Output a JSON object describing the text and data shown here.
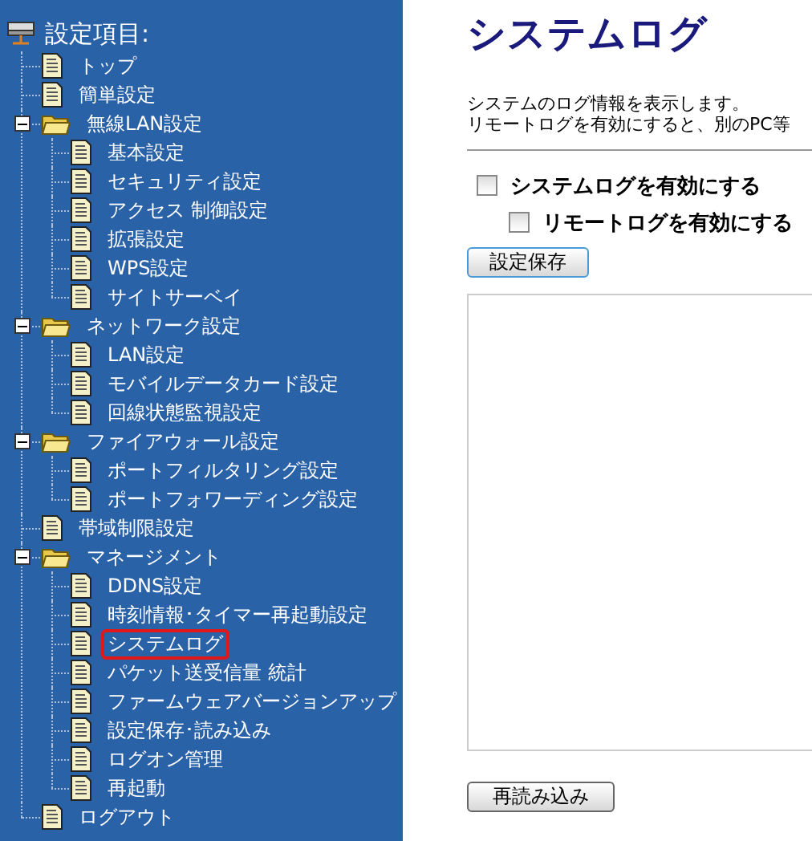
{
  "sidebar": {
    "title": "設定項目:",
    "items": [
      {
        "kind": "page",
        "label": "トップ",
        "selected": false
      },
      {
        "kind": "page",
        "label": "簡単設定",
        "selected": false
      },
      {
        "kind": "folder",
        "label": "無線LAN設定",
        "selected": false,
        "expanded": true,
        "children": [
          {
            "kind": "page",
            "label": "基本設定",
            "selected": false
          },
          {
            "kind": "page",
            "label": "セキュリティ設定",
            "selected": false
          },
          {
            "kind": "page",
            "label": "アクセス 制御設定",
            "selected": false
          },
          {
            "kind": "page",
            "label": "拡張設定",
            "selected": false
          },
          {
            "kind": "page",
            "label": "WPS設定",
            "selected": false
          },
          {
            "kind": "page",
            "label": "サイトサーベイ",
            "selected": false
          }
        ]
      },
      {
        "kind": "folder",
        "label": "ネットワーク設定",
        "selected": false,
        "expanded": true,
        "children": [
          {
            "kind": "page",
            "label": "LAN設定",
            "selected": false
          },
          {
            "kind": "page",
            "label": "モバイルデータカード設定",
            "selected": false
          },
          {
            "kind": "page",
            "label": "回線状態監視設定",
            "selected": false
          }
        ]
      },
      {
        "kind": "folder",
        "label": "ファイアウォール設定",
        "selected": false,
        "expanded": true,
        "children": [
          {
            "kind": "page",
            "label": "ポートフィルタリング設定",
            "selected": false
          },
          {
            "kind": "page",
            "label": "ポートフォワーディング設定",
            "selected": false
          }
        ]
      },
      {
        "kind": "page",
        "label": "帯域制限設定",
        "selected": false
      },
      {
        "kind": "folder",
        "label": "マネージメント",
        "selected": false,
        "expanded": true,
        "children": [
          {
            "kind": "page",
            "label": "DDNS設定",
            "selected": false
          },
          {
            "kind": "page",
            "label": "時刻情報･タイマー再起動設定",
            "selected": false
          },
          {
            "kind": "page",
            "label": "システムログ",
            "selected": true
          },
          {
            "kind": "page",
            "label": "パケット送受信量 統計",
            "selected": false
          },
          {
            "kind": "page",
            "label": "ファームウェアバージョンアップ",
            "selected": false
          },
          {
            "kind": "page",
            "label": "設定保存･読み込み",
            "selected": false
          },
          {
            "kind": "page",
            "label": "ログオン管理",
            "selected": false
          },
          {
            "kind": "page",
            "label": "再起動",
            "selected": false
          }
        ]
      },
      {
        "kind": "page",
        "label": "ログアウト",
        "selected": false
      }
    ]
  },
  "main": {
    "title": "システムログ",
    "description": [
      "システムのログ情報を表示します。",
      "リモートログを有効にすると、別のPC等"
    ],
    "options": [
      {
        "label": "システムログを有効にする",
        "checked": false,
        "children": [
          {
            "label": "リモートログを有効にする",
            "checked": false
          }
        ]
      }
    ],
    "save_button": "設定保存",
    "reload_button": "再読み込み"
  }
}
